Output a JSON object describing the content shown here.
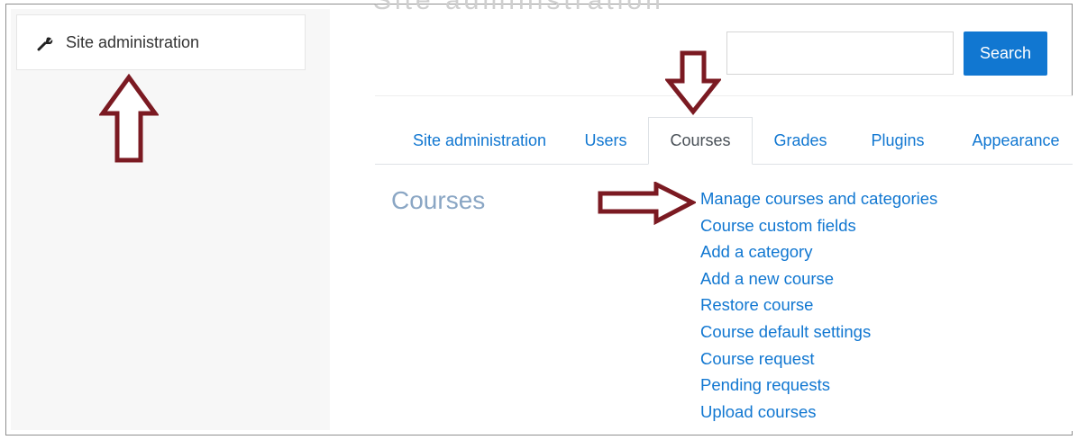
{
  "sidebar": {
    "item": {
      "label": "Site administration",
      "icon": "wrench-icon"
    }
  },
  "page": {
    "heading": "Site administration"
  },
  "search": {
    "placeholder": "",
    "button_label": "Search"
  },
  "tabs": [
    {
      "label": "Site administration",
      "active": false
    },
    {
      "label": "Users",
      "active": false
    },
    {
      "label": "Courses",
      "active": true
    },
    {
      "label": "Grades",
      "active": false
    },
    {
      "label": "Plugins",
      "active": false
    },
    {
      "label": "Appearance",
      "active": false
    }
  ],
  "section": {
    "title": "Courses",
    "links": [
      "Manage courses and categories",
      "Course custom fields",
      "Add a category",
      "Add a new course",
      "Restore course",
      "Course default settings",
      "Course request",
      "Pending requests",
      "Upload courses"
    ]
  },
  "colors": {
    "link": "#1177d1",
    "button": "#1177d1",
    "arrow_outline": "#7b1a22"
  },
  "annotations": [
    {
      "icon": "up-arrow-icon",
      "target": "sidebar-site-administration"
    },
    {
      "icon": "down-arrow-icon",
      "target": "tab-courses"
    },
    {
      "icon": "right-arrow-icon",
      "target": "link-manage-courses-and-categories"
    }
  ]
}
